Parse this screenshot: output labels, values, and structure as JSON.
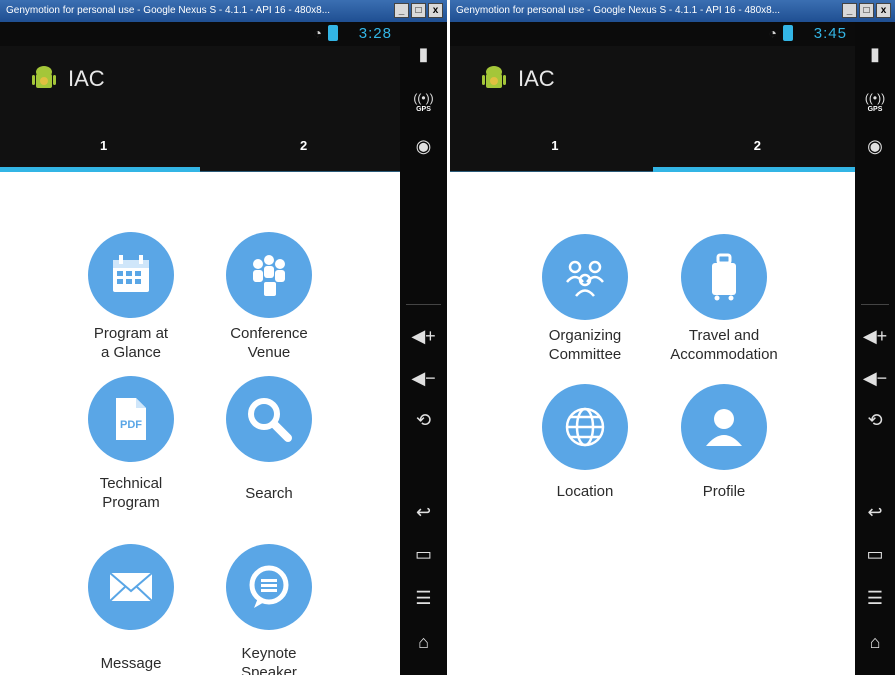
{
  "window": {
    "left_title": "Genymotion for personal use - Google Nexus S - 4.1.1 - API 16 - 480x8...",
    "right_title": "Genymotion for personal use - Google Nexus S - 4.1.1 - API 16 - 480x8...",
    "min_label": "_",
    "max_label": "□",
    "close_label": "x"
  },
  "left": {
    "time": "3:28",
    "app_title": "IAC",
    "tabs": [
      "1",
      "2"
    ],
    "active_tab": 0,
    "items": [
      {
        "label": "Program at\na Glance",
        "icon": "calendar-icon"
      },
      {
        "label": "Conference\nVenue",
        "icon": "people-icon"
      },
      {
        "label": "Technical\nProgram",
        "icon": "pdf-icon"
      },
      {
        "label": "Search",
        "icon": "search-icon"
      },
      {
        "label": "Message",
        "icon": "envelope-icon"
      },
      {
        "label": "Keynote\nSpeaker",
        "icon": "speech-bubble-icon"
      }
    ]
  },
  "right": {
    "time": "3:45",
    "app_title": "IAC",
    "tabs": [
      "1",
      "2"
    ],
    "active_tab": 1,
    "items": [
      {
        "label": "Organizing\nCommittee",
        "icon": "group-icon"
      },
      {
        "label": "Travel and\nAccommodation",
        "icon": "luggage-icon"
      },
      {
        "label": "Location",
        "icon": "globe-icon"
      },
      {
        "label": "Profile",
        "icon": "user-icon"
      }
    ]
  },
  "sidebar": {
    "gps_label": "GPS",
    "volume_up": "◀+",
    "volume_down": "◀−",
    "rotate": "⟲",
    "back": "↩",
    "recent": "▭",
    "menu": "☰",
    "home": "⌂"
  },
  "colors": {
    "accent": "#33b5e5",
    "icon_circle": "#5aa6e6",
    "bar": "#111111"
  }
}
